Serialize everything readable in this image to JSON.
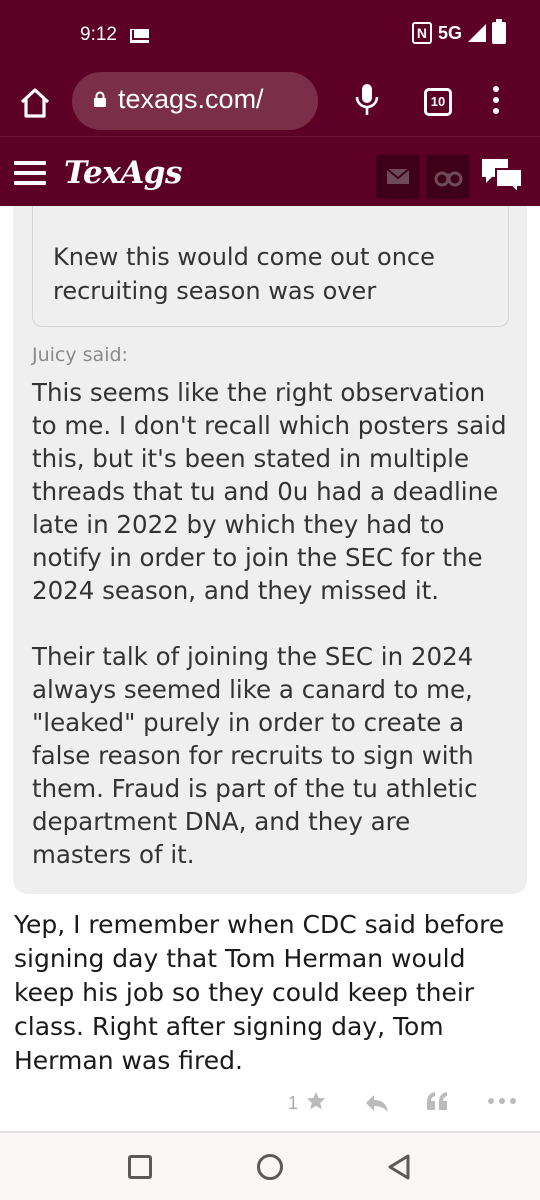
{
  "status_bar": {
    "time": "9:12",
    "network": "5G",
    "nfc": "N"
  },
  "browser": {
    "url": "texags.com/",
    "tab_count": "10"
  },
  "site": {
    "logo": "TexAgs"
  },
  "quote": {
    "nested_text": "Knew this would come out once recruiting season was over",
    "attribution": "Juicy said:",
    "paragraphs": [
      "This seems like the right observation to me. I don't recall which posters said this, but it's been stated in multiple threads that tu and 0u had a deadline late in 2022 by which they had to notify in order to join the SEC for the 2024 season, and they missed it.",
      "Their talk of joining the SEC in 2024 always seemed like a canard to me, \"leaked\" purely in order to create a false reason for recruits to sign with them. Fraud is part of the tu athletic department DNA, and they are masters of it."
    ]
  },
  "post": {
    "body": "Yep, I remember when CDC said before signing day that Tom Herman would keep his job so they could keep their class. Right after signing day, Tom Herman was fired.",
    "star_count": "1"
  },
  "colors": {
    "brand": "#5d0025",
    "quote_bg": "#efefef",
    "icon_gray": "#aaaaaa"
  }
}
